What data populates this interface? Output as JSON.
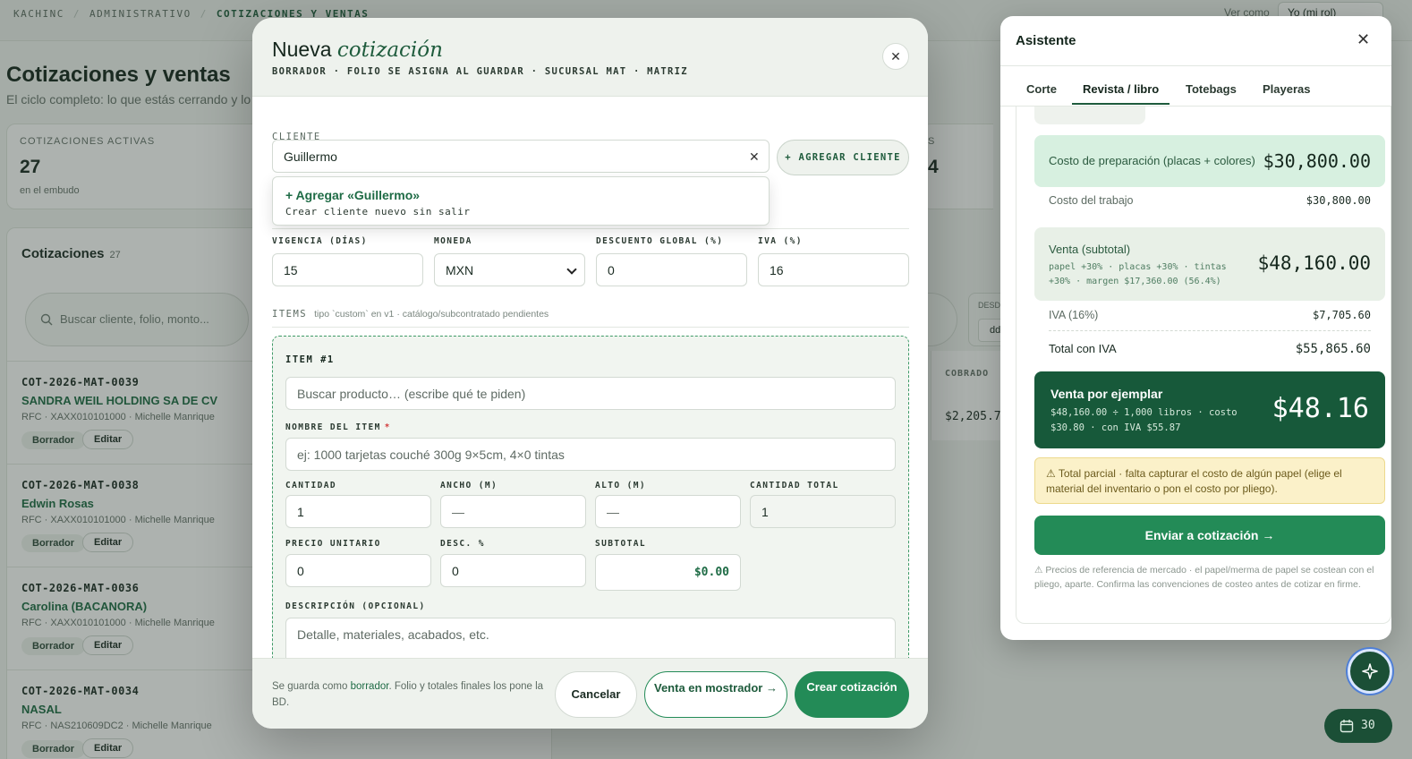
{
  "breadcrumb": [
    "KACHINC",
    "ADMINISTRATIVO",
    "COTIZACIONES Y VENTAS"
  ],
  "view_as": {
    "label": "Ver como",
    "value": "Yo (mi rol)"
  },
  "page": {
    "title": "Cotizaciones y ventas",
    "subtitle": "El ciclo completo: lo que estás cerrando y lo qu",
    "stat_active": {
      "label": "COTIZACIONES ACTIVAS",
      "value": "27",
      "hint": "en el embudo"
    },
    "stat_partial": {
      "label": "S",
      "value": "4"
    }
  },
  "quotes_list": {
    "title": "Cotizaciones",
    "count": "27",
    "search_placeholder": "Buscar cliente, folio, monto...",
    "desde_label": "DESD",
    "desde_value": "dd",
    "col_cobrado": "COBRADO",
    "cobrado_value": "$2,205.7",
    "rows": [
      {
        "folio": "COT-2026-MAT-0039",
        "client": "SANDRA WEIL HOLDING SA DE CV",
        "meta": "RFC · XAXX010101000 · Michelle Manrique",
        "badge": "Borrador",
        "edit": "Editar"
      },
      {
        "folio": "COT-2026-MAT-0038",
        "client": "Edwin Rosas",
        "meta": "RFC · XAXX010101000 · Michelle Manrique",
        "badge": "Borrador",
        "edit": "Editar"
      },
      {
        "folio": "COT-2026-MAT-0036",
        "client": "Carolina (BACANORA)",
        "meta": "RFC · XAXX010101000 · Michelle Manrique",
        "badge": "Borrador",
        "edit": "Editar"
      },
      {
        "folio": "COT-2026-MAT-0034",
        "client": "NASAL",
        "meta": "RFC · NAS210609DC2 · Michelle Manrique",
        "badge": "Borrador",
        "edit": "Editar"
      }
    ]
  },
  "modal": {
    "title_plain": "Nueva",
    "title_em": "cotización",
    "subtitle": "BORRADOR · FOLIO SE ASIGNA AL GUARDAR · SUCURSAL MAT · MATRIZ",
    "client_label": "CLIENTE",
    "client_value": "Guillermo",
    "add_client": "+ AGREGAR CLIENTE",
    "suggest_title": "+ Agregar «Guillermo»",
    "suggest_sub": "Crear cliente nuevo sin salir",
    "vigencia_label": "VIGENCIA (DÍAS)",
    "vigencia_value": "15",
    "moneda_label": "MONEDA",
    "moneda_value": "MXN",
    "descuento_label": "DESCUENTO GLOBAL (%)",
    "descuento_value": "0",
    "iva_label": "IVA (%)",
    "iva_value": "16",
    "items_label": "ITEMS",
    "items_note": "tipo `custom` en v1 · catálogo/subcontratado pendientes",
    "item": {
      "title": "ITEM #1",
      "product_placeholder": "Buscar producto… (escribe qué te piden)",
      "name_label": "NOMBRE DEL ITEM",
      "name_placeholder": "ej: 1000 tarjetas couché 300g 9×5cm, 4×0 tintas",
      "qty_label": "CANTIDAD",
      "qty_value": "1",
      "width_label": "ANCHO (M)",
      "width_value": "—",
      "height_label": "ALTO (M)",
      "height_value": "—",
      "total_qty_label": "CANTIDAD TOTAL",
      "total_qty_value": "1",
      "unit_price_label": "PRECIO UNITARIO",
      "unit_price_value": "0",
      "disc_label": "DESC. %",
      "disc_value": "0",
      "subtotal_label": "SUBTOTAL",
      "subtotal_value": "$0.00",
      "desc_label": "DESCRIPCIÓN (OPCIONAL)",
      "desc_placeholder": "Detalle, materiales, acabados, etc."
    },
    "foot_note_pre": "Se guarda como ",
    "foot_note_link": "borrador",
    "foot_note_post": ". Folio y totales finales los pone la BD.",
    "cancel": "Cancelar",
    "counter_sale": "Venta en mostrador →",
    "create": "Crear cotización"
  },
  "assistant": {
    "title": "Asistente",
    "tabs": [
      "Corte",
      "Revista / libro",
      "Totebags",
      "Playeras"
    ],
    "active_tab": "Revista / libro",
    "prep_label": "Costo de preparación (placas + colores)",
    "prep_value": "$30,800.00",
    "job_cost_label": "Costo del trabajo",
    "job_cost_value": "$30,800.00",
    "sale_label": "Venta (subtotal)",
    "sale_detail": "papel +30% · placas +30% · tintas +30% · margen $17,360.00 (56.4%)",
    "sale_value": "$48,160.00",
    "iva_label": "IVA (16%)",
    "iva_value": "$7,705.60",
    "total_label": "Total con IVA",
    "total_value": "$55,865.60",
    "per_copy_label": "Venta por ejemplar",
    "per_copy_detail": "$48,160.00 ÷ 1,000 libros · costo $30.80 · con IVA $55.87",
    "per_copy_value": "$48.16",
    "warning": "⚠ Total parcial · falta capturar el costo de algún papel (elige el material del inventario o pon el costo por pliego).",
    "send": "Enviar a cotización →",
    "disclaimer": "⚠ Precios de referencia de mercado · el papel/merma de papel se costean con el pliego, aparte. Confirma las convenciones de costeo antes de cotizar en firme."
  },
  "calendar_badge": "30",
  "colors": {
    "accent": "#238b57",
    "dark_green": "#17593a",
    "warning_bg": "#fbf1c9"
  }
}
